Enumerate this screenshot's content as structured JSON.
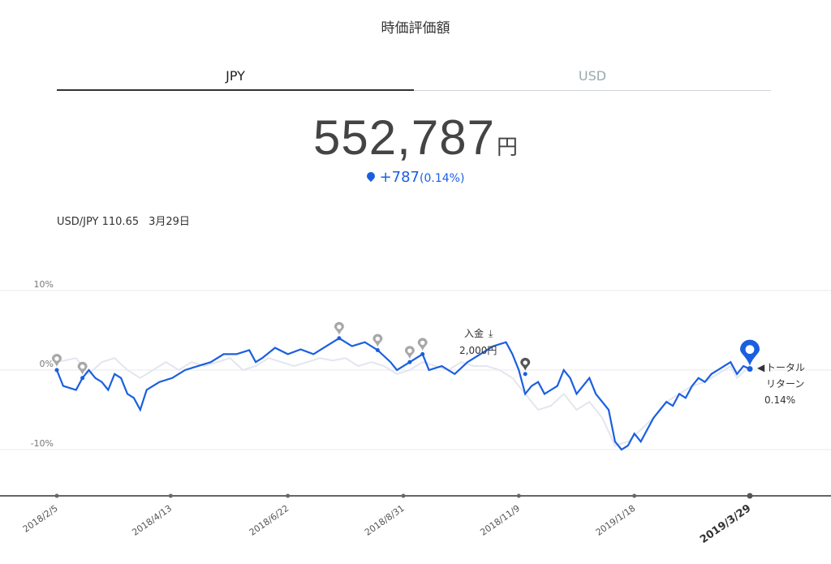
{
  "header": {
    "title": "時価評価額"
  },
  "tabs": [
    {
      "label": "JPY",
      "active": true
    },
    {
      "label": "USD",
      "active": false
    }
  ],
  "valuation": {
    "amount": "552,787",
    "unit": "円",
    "change": "+787",
    "change_pct": "(0.14%)"
  },
  "fx": {
    "pair": "USD/JPY 110.65",
    "date": "3月29日"
  },
  "colors": {
    "main_line": "#1a5fe0",
    "benchmark_line": "#e3e6ee",
    "pin_gray": "#a8a8a8",
    "pin_dark": "#555555"
  },
  "annotation": {
    "deposit_label": "入金",
    "deposit_amount": "2,000円",
    "total_return_line1": "トータル",
    "total_return_line2": "リターン",
    "total_return_value": "0.14%"
  },
  "chart_data": {
    "type": "line",
    "x_ticks": [
      "2018/2/5",
      "2018/4/13",
      "2018/6/22",
      "2018/8/31",
      "2018/11/9",
      "2019/1/18",
      "2019/3/29"
    ],
    "y_ticks": [
      "10%",
      "0%",
      "-10%"
    ],
    "ylim": [
      -16,
      10
    ],
    "series": [
      {
        "points": [
          [
            0,
            0
          ],
          [
            1,
            -2
          ],
          [
            3,
            -2.5
          ],
          [
            4,
            -1
          ],
          [
            5,
            0
          ],
          [
            6,
            -1
          ],
          [
            7,
            -1.5
          ],
          [
            8,
            -2.5
          ],
          [
            9,
            -0.5
          ],
          [
            10,
            -1
          ],
          [
            11,
            -3
          ],
          [
            12,
            -3.5
          ],
          [
            13,
            -5
          ],
          [
            14,
            -2.5
          ],
          [
            15,
            -2
          ],
          [
            16,
            -1.5
          ],
          [
            18,
            -1
          ],
          [
            20,
            0
          ],
          [
            22,
            0.5
          ],
          [
            24,
            1
          ],
          [
            26,
            2
          ],
          [
            28,
            2
          ],
          [
            30,
            2.5
          ],
          [
            31,
            1
          ],
          [
            32,
            1.5
          ],
          [
            34,
            2.8
          ],
          [
            36,
            2
          ],
          [
            38,
            2.6
          ],
          [
            40,
            2
          ],
          [
            42,
            3
          ],
          [
            44,
            4
          ],
          [
            46,
            3
          ],
          [
            48,
            3.5
          ],
          [
            50,
            2.5
          ],
          [
            52,
            1
          ],
          [
            53,
            0
          ],
          [
            55,
            1
          ],
          [
            57,
            2
          ],
          [
            58,
            0
          ],
          [
            60,
            0.5
          ],
          [
            62,
            -0.5
          ],
          [
            64,
            1
          ],
          [
            66,
            2
          ],
          [
            68,
            3
          ],
          [
            70,
            3.5
          ],
          [
            71,
            2
          ],
          [
            72,
            0
          ],
          [
            73,
            -3
          ],
          [
            74,
            -2
          ],
          [
            75,
            -1.5
          ],
          [
            76,
            -3
          ],
          [
            77,
            -2.5
          ],
          [
            78,
            -2
          ],
          [
            79,
            0
          ],
          [
            80,
            -1
          ],
          [
            81,
            -3
          ],
          [
            82,
            -2
          ],
          [
            83,
            -1
          ],
          [
            84,
            -3
          ],
          [
            85,
            -4
          ],
          [
            86,
            -5
          ],
          [
            87,
            -9
          ],
          [
            88,
            -10
          ],
          [
            89,
            -9.5
          ],
          [
            90,
            -8
          ],
          [
            91,
            -9
          ],
          [
            92,
            -7.5
          ],
          [
            93,
            -6
          ],
          [
            94,
            -5
          ],
          [
            95,
            -4
          ],
          [
            96,
            -4.5
          ],
          [
            97,
            -3
          ],
          [
            98,
            -3.5
          ],
          [
            99,
            -2
          ],
          [
            100,
            -1
          ],
          [
            101,
            -1.5
          ],
          [
            102,
            -0.5
          ],
          [
            103,
            0
          ],
          [
            104,
            0.5
          ],
          [
            105,
            1
          ],
          [
            106,
            -0.5
          ],
          [
            107,
            0.5
          ],
          [
            108,
            0.14
          ]
        ]
      },
      {
        "points": [
          [
            0,
            1
          ],
          [
            3,
            1.5
          ],
          [
            5,
            -0.5
          ],
          [
            7,
            1
          ],
          [
            9,
            1.5
          ],
          [
            11,
            0
          ],
          [
            13,
            -1
          ],
          [
            15,
            0
          ],
          [
            17,
            1
          ],
          [
            19,
            0
          ],
          [
            21,
            1
          ],
          [
            23,
            0.5
          ],
          [
            25,
            1
          ],
          [
            27,
            1.5
          ],
          [
            29,
            0
          ],
          [
            31,
            0.5
          ],
          [
            33,
            1.5
          ],
          [
            35,
            1
          ],
          [
            37,
            0.5
          ],
          [
            39,
            1
          ],
          [
            41,
            1.5
          ],
          [
            43,
            1.2
          ],
          [
            45,
            1.5
          ],
          [
            47,
            0.5
          ],
          [
            49,
            1
          ],
          [
            51,
            0.5
          ],
          [
            53,
            -0.5
          ],
          [
            55,
            0
          ],
          [
            57,
            1
          ],
          [
            59,
            0.5
          ],
          [
            61,
            0
          ],
          [
            63,
            1
          ],
          [
            65,
            0.5
          ],
          [
            67,
            0.5
          ],
          [
            69,
            0
          ],
          [
            71,
            -1
          ],
          [
            73,
            -3
          ],
          [
            75,
            -5
          ],
          [
            77,
            -4.5
          ],
          [
            79,
            -3
          ],
          [
            81,
            -5
          ],
          [
            83,
            -4
          ],
          [
            85,
            -6
          ],
          [
            87,
            -9.5
          ],
          [
            89,
            -9
          ],
          [
            91,
            -7.5
          ],
          [
            93,
            -6
          ],
          [
            95,
            -4
          ],
          [
            97,
            -3
          ],
          [
            99,
            -2
          ],
          [
            101,
            -1.5
          ],
          [
            103,
            -0.5
          ],
          [
            105,
            0.5
          ],
          [
            106,
            -1
          ],
          [
            108,
            0.5
          ]
        ]
      }
    ]
  }
}
